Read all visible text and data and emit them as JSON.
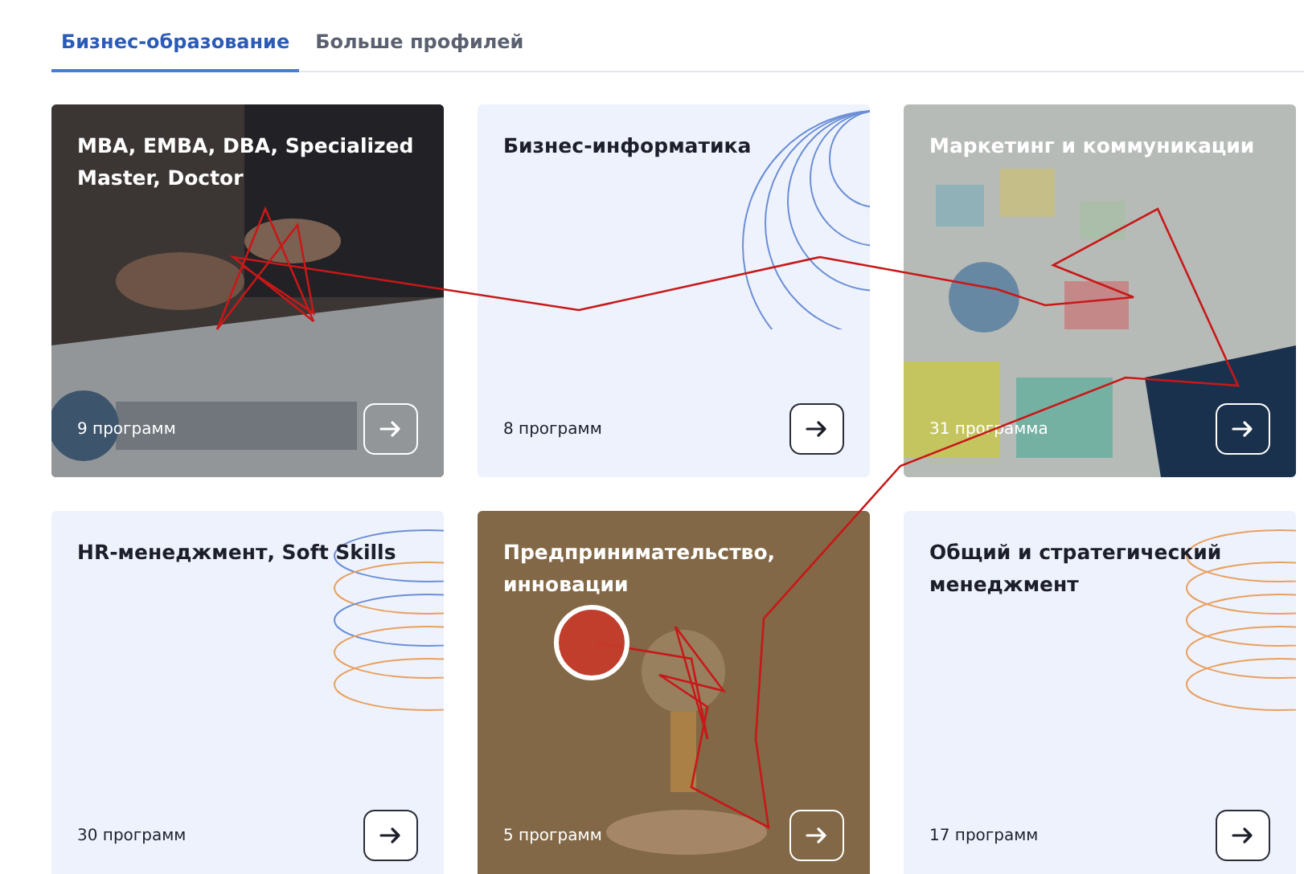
{
  "tabs": [
    {
      "label": "Бизнес-образование",
      "selected": true
    },
    {
      "label": "Больше профилей",
      "selected": false
    }
  ],
  "cards": [
    {
      "title": "MBA, EMBA, DBA, Specialized Master, Doctor",
      "count": "9 программ",
      "kind": "picture"
    },
    {
      "title": "Бизнес-информатика",
      "count": "8 программ",
      "kind": "arcs"
    },
    {
      "title": "Маркетинг и коммуникации",
      "count": "31 программа",
      "kind": "picture"
    },
    {
      "title": "HR-менеджмент, Soft Skills",
      "count": "30 программ",
      "kind": "rings-mixed"
    },
    {
      "title": "Предпринимательство, инновации",
      "count": "5 программ",
      "kind": "picture"
    },
    {
      "title": "Общий и стратегический менеджмент",
      "count": "17 программ",
      "kind": "rings"
    }
  ]
}
